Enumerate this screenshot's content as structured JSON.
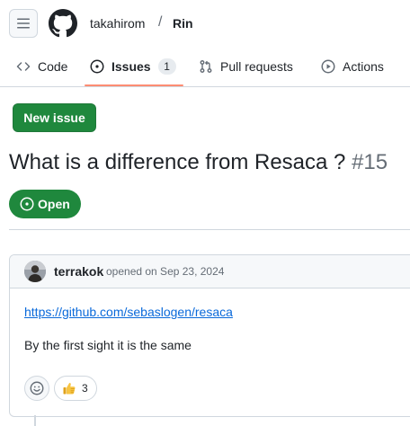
{
  "header": {
    "menu_icon": "hamburger-icon",
    "logo_icon": "github-mark-icon",
    "owner": "takahirom",
    "separator": "/",
    "repo": "Rin"
  },
  "tabs": [
    {
      "label": "Code",
      "icon": "code-icon"
    },
    {
      "label": "Issues",
      "icon": "issue-opened-icon",
      "count": "1",
      "selected": true
    },
    {
      "label": "Pull requests",
      "icon": "git-pull-request-icon"
    },
    {
      "label": "Actions",
      "icon": "play-icon"
    }
  ],
  "main": {
    "new_issue_label": "New issue",
    "issue_title": "What is a difference from Resaca ?",
    "issue_number": "#15",
    "state_label": "Open",
    "state_icon": "issue-opened-icon"
  },
  "comment": {
    "author": "terrakok",
    "opened_text": "opened on Sep 23, 2024",
    "link_text": "https://github.com/sebaslogen/resaca",
    "body_text": "By the first sight it is the same",
    "reactions": [
      {
        "emoji": "thumbs-up-icon",
        "count": "3"
      }
    ],
    "add_reaction_icon": "smiley-icon"
  },
  "colors": {
    "accent_green": "#1f883d",
    "link_blue": "#0969da",
    "tab_underline": "#fd8c73",
    "border": "#d0d7de",
    "muted_text": "#656d76"
  }
}
